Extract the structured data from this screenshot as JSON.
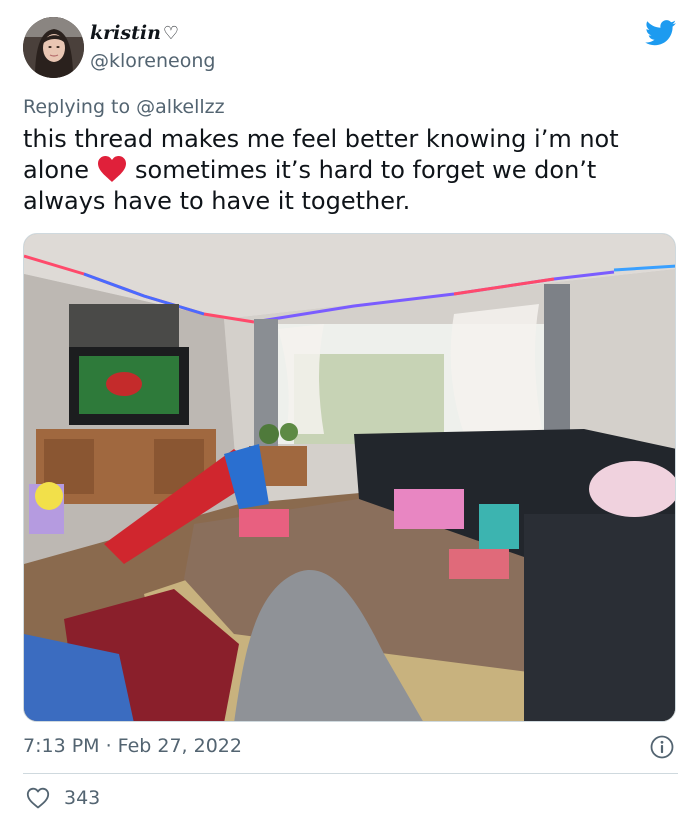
{
  "tweet": {
    "display_name": "kristin",
    "name_suffix": "♡",
    "handle": "@kloreneong",
    "replying_to": "Replying to @alkellzz",
    "text_part1": "this thread makes me feel better knowing i’m not alone",
    "text_part2": "sometimes it’s hard to forget we don’t always have to have it together.",
    "emoji": "red-heart-emoji",
    "photo": "living-room-photo",
    "timestamp": "7:13 PM · Feb 27, 2022",
    "like_count": "343"
  },
  "colors": {
    "text": "#0f1419",
    "muted": "#536471",
    "twitter_blue": "#1d9bf0",
    "heart_red": "#e0203a",
    "divider": "#cfd9de"
  },
  "icons": [
    "twitter-bird-icon",
    "info-icon",
    "like-heart-icon"
  ]
}
